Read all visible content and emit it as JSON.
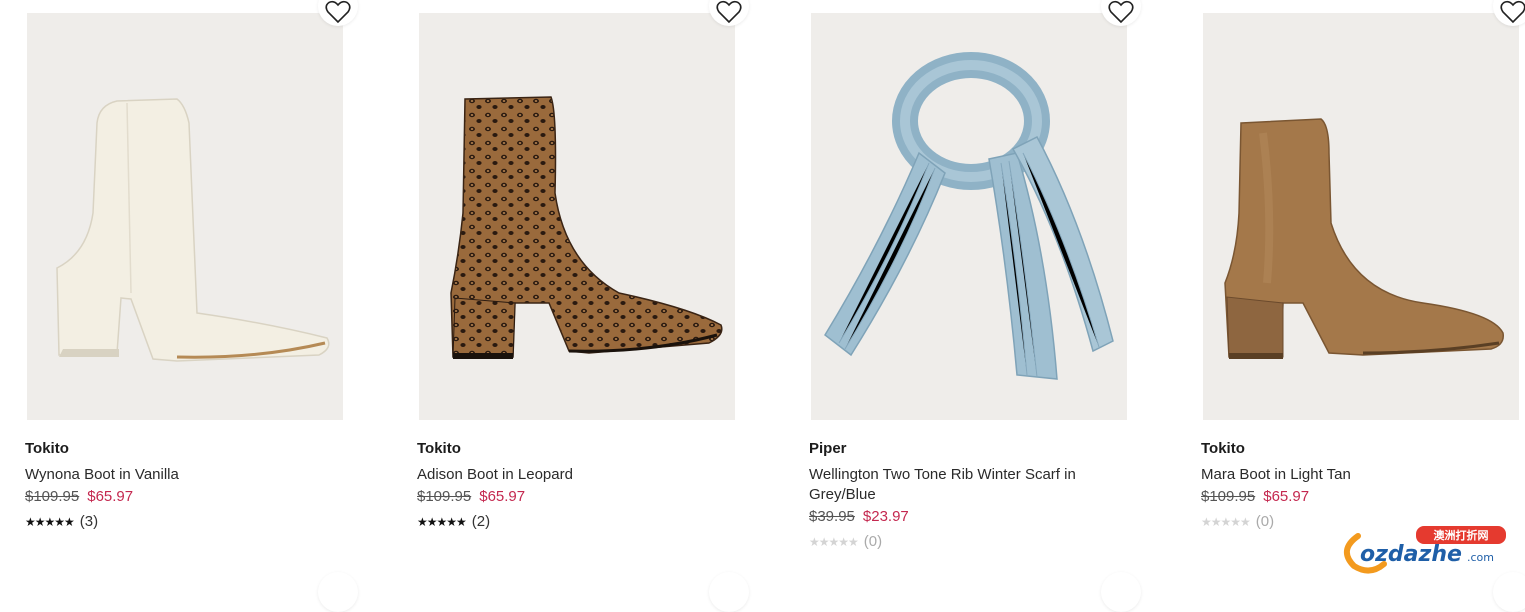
{
  "products": [
    {
      "brand": "Tokito",
      "name": "Wynona Boot in Vanilla",
      "price_old": "$109.95",
      "price_new": "$65.97",
      "stars": "★★★★★",
      "review_count": "(3)",
      "rating": 5,
      "image_icon": "boot-vanilla"
    },
    {
      "brand": "Tokito",
      "name": "Adison Boot in Leopard",
      "price_old": "$109.95",
      "price_new": "$65.97",
      "stars": "★★★★★",
      "review_count": "(2)",
      "rating": 5,
      "image_icon": "boot-leopard"
    },
    {
      "brand": "Piper",
      "name": "Wellington Two Tone Rib Winter Scarf in Grey/Blue",
      "price_old": "$39.95",
      "price_new": "$23.97",
      "stars": "★★★★★",
      "review_count": "(0)",
      "rating": 0,
      "image_icon": "scarf-grey-blue"
    },
    {
      "brand": "Tokito",
      "name": "Mara Boot in Light Tan",
      "price_old": "$109.95",
      "price_new": "$65.97",
      "stars": "★★★★★",
      "review_count": "(0)",
      "rating": 0,
      "image_icon": "boot-light-tan"
    }
  ],
  "watermark": {
    "brand": "ozdazhe",
    "suffix": ".com",
    "tag": "澳洲打折网"
  },
  "colors": {
    "sale_price": "#c4284f",
    "image_bg": "#efedea",
    "watermark_orange": "#f39a1e",
    "watermark_blue": "#1f5fa8"
  }
}
